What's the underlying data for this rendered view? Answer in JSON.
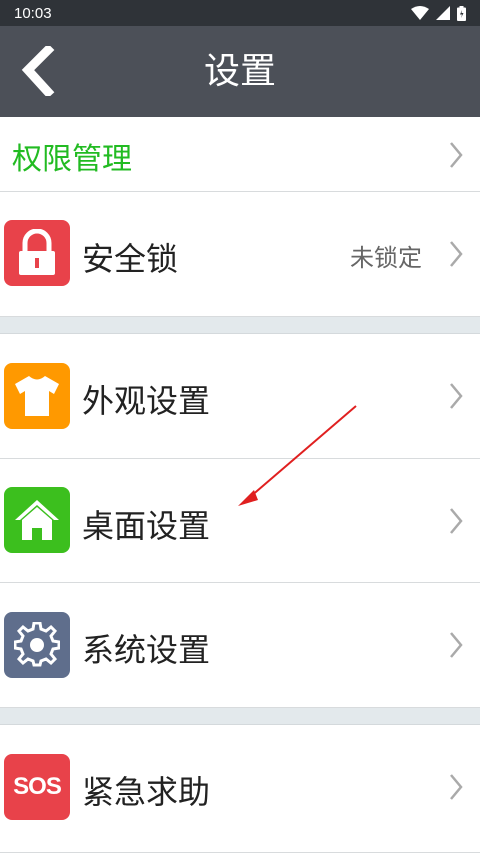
{
  "status_bar": {
    "time": "10:03"
  },
  "header": {
    "title": "设置"
  },
  "items": {
    "permissions": {
      "label": "权限管理"
    },
    "security_lock": {
      "label": "安全锁",
      "value": "未锁定",
      "icon_color": "#e8424a"
    },
    "appearance": {
      "label": "外观设置",
      "icon_color": "#ff9900"
    },
    "desktop": {
      "label": "桌面设置",
      "icon_color": "#3cbf1e"
    },
    "system": {
      "label": "系统设置",
      "icon_color": "#5f6e8c"
    },
    "emergency": {
      "label": "紧急求助",
      "icon_color": "#e8424a",
      "icon_text": "SOS"
    }
  },
  "colors": {
    "header_bg": "#4c5058",
    "status_bg": "#2f3338",
    "accent_green": "#22bb22",
    "annotation_arrow": "#e02020"
  }
}
